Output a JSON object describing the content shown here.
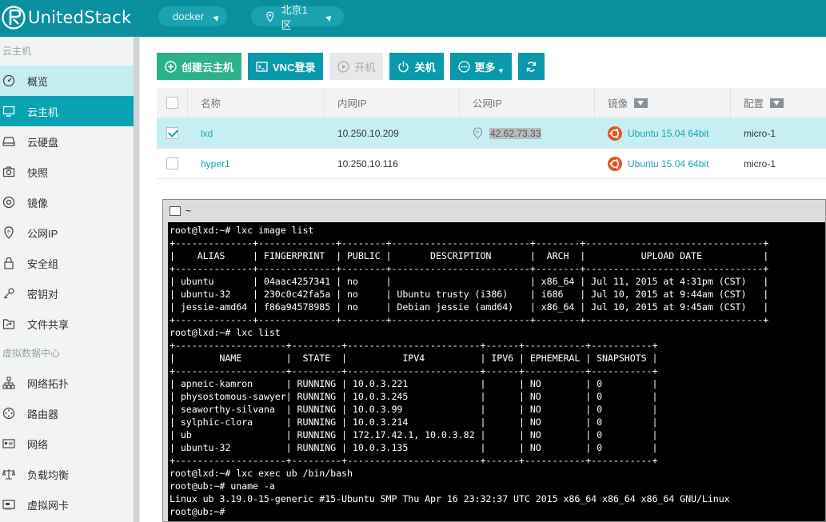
{
  "brand": {
    "name": "UnitedStack"
  },
  "topbar": {
    "project": "docker",
    "region": "北京1区"
  },
  "sidebar": {
    "sections": [
      {
        "title": "云主机",
        "items": [
          {
            "label": "概览",
            "icon": "dashboard-icon",
            "state": "light"
          },
          {
            "label": "云主机",
            "icon": "monitor-icon",
            "state": "active"
          },
          {
            "label": "云硬盘",
            "icon": "disk-icon",
            "state": ""
          },
          {
            "label": "快照",
            "icon": "camera-icon",
            "state": ""
          },
          {
            "label": "镜像",
            "icon": "image-disc-icon",
            "state": ""
          },
          {
            "label": "公网IP",
            "icon": "public-ip-icon",
            "state": ""
          },
          {
            "label": "安全组",
            "icon": "lock-icon",
            "state": ""
          },
          {
            "label": "密钥对",
            "icon": "key-icon",
            "state": ""
          },
          {
            "label": "文件共享",
            "icon": "folder-share-icon",
            "state": ""
          }
        ]
      },
      {
        "title": "虚拟数据中心",
        "items": [
          {
            "label": "网络拓扑",
            "icon": "topology-icon",
            "state": ""
          },
          {
            "label": "路由器",
            "icon": "router-icon",
            "state": ""
          },
          {
            "label": "网络",
            "icon": "network-icon",
            "state": ""
          },
          {
            "label": "负载均衡",
            "icon": "balance-icon",
            "state": ""
          },
          {
            "label": "虚拟网卡",
            "icon": "nic-icon",
            "state": ""
          }
        ]
      }
    ]
  },
  "toolbar": {
    "create": "创建云主机",
    "vnc": "VNC登录",
    "start": "开机",
    "stop": "关机",
    "more": "更多"
  },
  "table": {
    "headers": {
      "name": "名称",
      "private_ip": "内网IP",
      "public_ip": "公网IP",
      "image": "镜像",
      "flavor": "配置"
    },
    "rows": [
      {
        "checked": true,
        "name": "lxd",
        "private_ip": "10.250.10.209",
        "public_ip": "42.62.73.33",
        "image": "Ubuntu 15.04 64bit",
        "flavor": "micro-1"
      },
      {
        "checked": false,
        "name": "hyper1",
        "private_ip": "10.250.10.116",
        "public_ip": "",
        "image": "Ubuntu 15.04 64bit",
        "flavor": "micro-1"
      }
    ]
  },
  "terminal": {
    "title": "~",
    "lines": [
      "root@lxd:~# lxc image list",
      "+--------------+--------------+--------+-------------------------+--------+--------------------------------+",
      "|    ALIAS     | FINGERPRINT  | PUBLIC |       DESCRIPTION       |  ARCH  |          UPLOAD DATE           |",
      "+--------------+--------------+--------+-------------------------+--------+--------------------------------+",
      "| ubuntu       | 04aac4257341 | no     |                         | x86_64 | Jul 11, 2015 at 4:31pm (CST)   |",
      "| ubuntu-32    | 230c0c42fa5a | no     | Ubuntu trusty (i386)    | i686   | Jul 10, 2015 at 9:44am (CST)   |",
      "| jessie-amd64 | f86a94578985 | no     | Debian jessie (amd64)   | x86_64 | Jul 10, 2015 at 9:45am (CST)   |",
      "+--------------+--------------+--------+-------------------------+--------+--------------------------------+",
      "root@lxd:~# lxc list",
      "+--------------------+---------+------------------------+------+-----------+-----------+",
      "|        NAME        |  STATE  |          IPV4          | IPV6 | EPHEMERAL | SNAPSHOTS |",
      "+--------------------+---------+------------------------+------+-----------+-----------+",
      "| apneic-kamron      | RUNNING | 10.0.3.221             |      | NO        | 0         |",
      "| physostomous-sawyer| RUNNING | 10.0.3.245             |      | NO        | 0         |",
      "| seaworthy-silvana  | RUNNING | 10.0.3.99              |      | NO        | 0         |",
      "| sylphic-clora      | RUNNING | 10.0.3.214             |      | NO        | 0         |",
      "| ub                 | RUNNING | 172.17.42.1, 10.0.3.82 |      | NO        | 0         |",
      "| ubuntu-32          | RUNNING | 10.0.3.135             |      | NO        | 0         |",
      "+--------------------+---------+------------------------+------+-----------+-----------+",
      "root@lxd:~# lxc exec ub /bin/bash",
      "root@ub:~# uname -a",
      "Linux ub 3.19.0-15-generic #15-Ubuntu SMP Thu Apr 16 23:32:37 UTC 2015 x86_64 x86_64 x86_64 GNU/Linux",
      "root@ub:~#"
    ]
  },
  "colors": {
    "brand": "#0a8f9e",
    "accent": "#0aa3b3",
    "create": "#2bb28b",
    "ubuntu": "#e95420"
  }
}
